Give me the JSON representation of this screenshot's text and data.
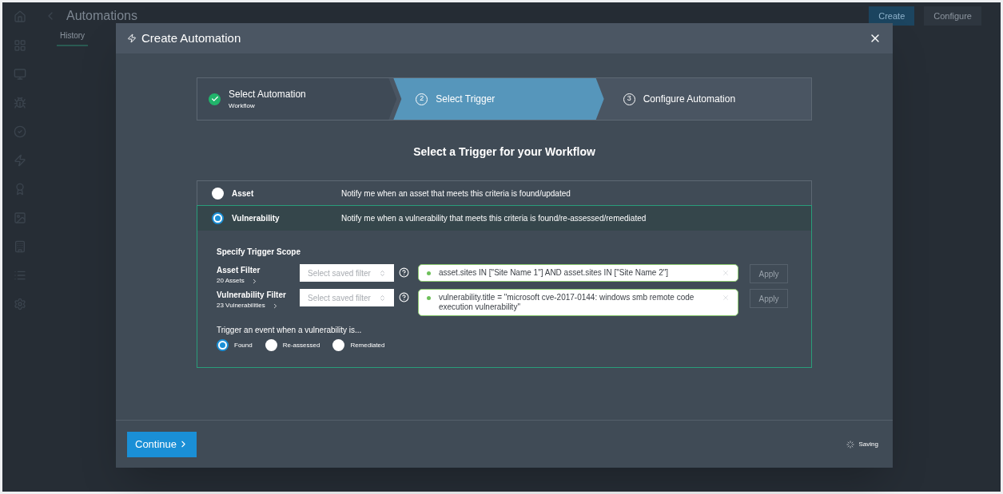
{
  "background": {
    "title": "Automations",
    "tabs": [
      {
        "label": "History",
        "selected": true
      }
    ],
    "buttons": [
      {
        "label": "Create",
        "kind": "primary"
      },
      {
        "label": "Configure",
        "kind": "secondary"
      }
    ]
  },
  "dialog": {
    "title": "Create Automation",
    "steps": [
      {
        "label": "Select Automation",
        "sublabel": "Workflow",
        "completed": true,
        "selected": false
      },
      {
        "number": "2",
        "label": "Select Trigger",
        "completed": false,
        "selected": true
      },
      {
        "number": "3",
        "label": "Configure Automation",
        "completed": false,
        "selected": false
      }
    ],
    "heading": "Select a Trigger for your Workflow",
    "triggers": [
      {
        "label": "Asset",
        "description": "Notify me when an asset that meets this criteria is found/updated",
        "selected": false
      },
      {
        "label": "Vulnerability",
        "description": "Notify me when a vulnerability that meets this criteria is found/re-assessed/remediated",
        "selected": true
      }
    ],
    "scope": {
      "title": "Specify Trigger Scope",
      "filters": [
        {
          "label": "Asset Filter",
          "count": "20 Assets",
          "placeholder": "Select saved filter",
          "query": "asset.sites IN [\"Site Name 1\"] AND asset.sites IN [\"Site Name 2\"]",
          "apply": {
            "label": "Apply",
            "disabled": true
          }
        },
        {
          "label": "Vulnerability Filter",
          "count": "23 Vulnerabilities",
          "placeholder": "Select saved filter",
          "query": "vulnerability.title = \"microsoft cve-2017-0144: windows smb remote code execution vulnerability\"",
          "apply": {
            "label": "Apply",
            "disabled": true
          }
        }
      ],
      "event_prompt": "Trigger an event when a vulnerability is...",
      "events": [
        {
          "label": "Found",
          "selected": true
        },
        {
          "label": "Re-assessed",
          "selected": false
        },
        {
          "label": "Remediated",
          "selected": false
        }
      ]
    },
    "continue": "Continue",
    "status": "Saving"
  }
}
